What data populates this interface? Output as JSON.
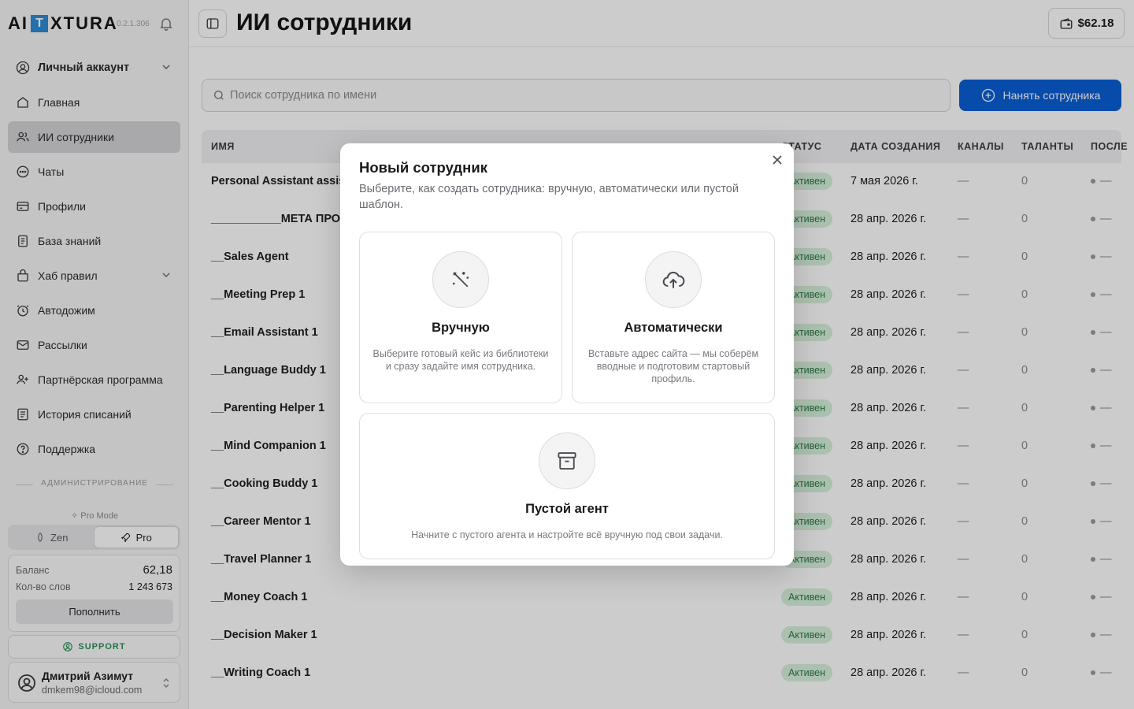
{
  "brand": {
    "left": "AI",
    "box": "T",
    "right": "XTURA",
    "version": "0.2.1.306"
  },
  "sidebar": {
    "account": "Личный аккаунт",
    "items": [
      {
        "label": "Главная",
        "icon": "home-icon"
      },
      {
        "label": "ИИ сотрудники",
        "icon": "users-icon",
        "active": true
      },
      {
        "label": "Чаты",
        "icon": "chat-icon"
      },
      {
        "label": "Профили",
        "icon": "profile-card-icon"
      },
      {
        "label": "База знаний",
        "icon": "book-icon"
      },
      {
        "label": "Хаб правил",
        "icon": "rules-hub-icon",
        "expandable": true
      },
      {
        "label": "Автодожим",
        "icon": "clock-icon"
      },
      {
        "label": "Рассылки",
        "icon": "mail-icon"
      },
      {
        "label": "Партнёрская программа",
        "icon": "partners-icon"
      },
      {
        "label": "История списаний",
        "icon": "history-icon"
      },
      {
        "label": "Поддержка",
        "icon": "help-icon"
      }
    ],
    "admin_label": "АДМИНИСТРИРОВАНИЕ",
    "pro_mode_label": "Pro Mode",
    "mode_zen": "Zen",
    "mode_pro": "Pro",
    "balance_label": "Баланс",
    "balance_value": "62,18",
    "words_label": "Кол-во слов",
    "words_value": "1 243 673",
    "topup": "Пополнить",
    "support": "SUPPORT",
    "user_name": "Дмитрий Азимут",
    "user_email": "dmkem98@icloud.com"
  },
  "header": {
    "title": "ИИ сотрудники",
    "wallet": "$62.18"
  },
  "search": {
    "placeholder": "Поиск сотрудника по имени"
  },
  "hire_button": "Нанять сотрудника",
  "table": {
    "columns": [
      "ИМЯ",
      "СТАТУС",
      "ДАТА СОЗДАНИЯ",
      "КАНАЛЫ",
      "ТАЛАНТЫ",
      "ПОСЛЕ"
    ],
    "rows": [
      {
        "name": "Personal Assistant assistant",
        "status": "Активен",
        "date": "7 мая 2026 г.",
        "channels": "—",
        "talents": "0",
        "last": "—"
      },
      {
        "name": "___________МЕТА ПРОМПТ",
        "status": "Активен",
        "date": "28 апр. 2026 г.",
        "channels": "—",
        "talents": "0",
        "last": "—"
      },
      {
        "name": "__Sales Agent",
        "status": "Активен",
        "date": "28 апр. 2026 г.",
        "channels": "—",
        "talents": "0",
        "last": "—"
      },
      {
        "name": "__Meeting Prep 1",
        "status": "Активен",
        "date": "28 апр. 2026 г.",
        "channels": "—",
        "talents": "0",
        "last": "—"
      },
      {
        "name": "__Email Assistant 1",
        "status": "Активен",
        "date": "28 апр. 2026 г.",
        "channels": "—",
        "talents": "0",
        "last": "—"
      },
      {
        "name": "__Language Buddy 1",
        "status": "Активен",
        "date": "28 апр. 2026 г.",
        "channels": "—",
        "talents": "0",
        "last": "—"
      },
      {
        "name": "__Parenting Helper 1",
        "status": "Активен",
        "date": "28 апр. 2026 г.",
        "channels": "—",
        "talents": "0",
        "last": "—"
      },
      {
        "name": "__Mind Companion 1",
        "status": "Активен",
        "date": "28 апр. 2026 г.",
        "channels": "—",
        "talents": "0",
        "last": "—"
      },
      {
        "name": "__Cooking Buddy 1",
        "status": "Активен",
        "date": "28 апр. 2026 г.",
        "channels": "—",
        "talents": "0",
        "last": "—"
      },
      {
        "name": "__Career Mentor 1",
        "status": "Активен",
        "date": "28 апр. 2026 г.",
        "channels": "—",
        "talents": "0",
        "last": "—"
      },
      {
        "name": "__Travel Planner 1",
        "status": "Активен",
        "date": "28 апр. 2026 г.",
        "channels": "—",
        "talents": "0",
        "last": "—"
      },
      {
        "name": "__Money Coach 1",
        "status": "Активен",
        "date": "28 апр. 2026 г.",
        "channels": "—",
        "talents": "0",
        "last": "—"
      },
      {
        "name": "__Decision Maker 1",
        "status": "Активен",
        "date": "28 апр. 2026 г.",
        "channels": "—",
        "talents": "0",
        "last": "—"
      },
      {
        "name": "__Writing Coach 1",
        "status": "Активен",
        "date": "28 апр. 2026 г.",
        "channels": "—",
        "talents": "0",
        "last": "—"
      }
    ]
  },
  "modal": {
    "title": "Новый сотрудник",
    "subtitle": "Выберите, как создать сотрудника: вручную, автоматически или пустой шаблон.",
    "options": [
      {
        "title": "Вручную",
        "desc": "Выберите готовый кейс из библиотеки и сразу задайте имя сотрудника.",
        "icon": "wand-icon"
      },
      {
        "title": "Автоматически",
        "desc": "Вставьте адрес сайта — мы соберём вводные и подготовим стартовый профиль.",
        "icon": "cloud-upload-icon"
      },
      {
        "title": "Пустой агент",
        "desc": "Начните с пустого агента и настройте всё вручную под свои задачи.",
        "icon": "archive-box-icon"
      }
    ]
  },
  "colors": {
    "primary": "#0b5fd6",
    "status_bg": "#d7f0dd",
    "status_text": "#2b7a45",
    "support": "#2f8f5b"
  }
}
